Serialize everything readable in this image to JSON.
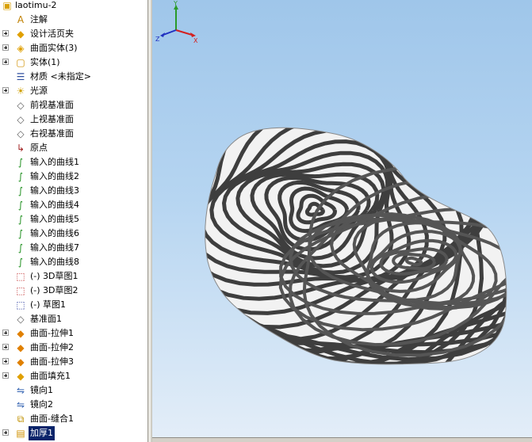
{
  "tree": {
    "root": {
      "label": "laotimu-2",
      "icon": "part-icon"
    },
    "items": [
      {
        "label": "注解",
        "icon": "annotation-icon",
        "expandable": false
      },
      {
        "label": "设计活页夹",
        "icon": "design-binder-icon",
        "expandable": true
      },
      {
        "label": "曲面实体(3)",
        "icon": "surface-bodies-icon",
        "expandable": true
      },
      {
        "label": "实体(1)",
        "icon": "solid-bodies-icon",
        "expandable": true
      },
      {
        "label": "材质 <未指定>",
        "icon": "material-icon",
        "expandable": false
      },
      {
        "label": "光源",
        "icon": "lights-icon",
        "expandable": true
      },
      {
        "label": "前视基准面",
        "icon": "plane-icon",
        "expandable": false
      },
      {
        "label": "上视基准面",
        "icon": "plane-icon",
        "expandable": false
      },
      {
        "label": "右视基准面",
        "icon": "plane-icon",
        "expandable": false
      },
      {
        "label": "原点",
        "icon": "origin-icon",
        "expandable": false
      },
      {
        "label": "输入的曲线1",
        "icon": "curve-icon",
        "expandable": false
      },
      {
        "label": "输入的曲线2",
        "icon": "curve-icon",
        "expandable": false
      },
      {
        "label": "输入的曲线3",
        "icon": "curve-icon",
        "expandable": false
      },
      {
        "label": "输入的曲线4",
        "icon": "curve-icon",
        "expandable": false
      },
      {
        "label": "输入的曲线5",
        "icon": "curve-icon",
        "expandable": false
      },
      {
        "label": "输入的曲线6",
        "icon": "curve-icon",
        "expandable": false
      },
      {
        "label": "输入的曲线7",
        "icon": "curve-icon",
        "expandable": false
      },
      {
        "label": "输入的曲线8",
        "icon": "curve-icon",
        "expandable": false
      },
      {
        "label": "(-) 3D草图1",
        "icon": "3d-sketch-icon",
        "expandable": false
      },
      {
        "label": "(-) 3D草图2",
        "icon": "3d-sketch-icon",
        "expandable": false
      },
      {
        "label": "(-) 草图1",
        "icon": "sketch-icon",
        "expandable": false
      },
      {
        "label": "基准面1",
        "icon": "plane-icon",
        "expandable": false
      },
      {
        "label": "曲面-拉伸1",
        "icon": "surface-extrude-icon",
        "expandable": true
      },
      {
        "label": "曲面-拉伸2",
        "icon": "surface-extrude-icon",
        "expandable": true
      },
      {
        "label": "曲面-拉伸3",
        "icon": "surface-extrude-icon",
        "expandable": true
      },
      {
        "label": "曲面填充1",
        "icon": "surface-fill-icon",
        "expandable": true
      },
      {
        "label": "镜向1",
        "icon": "mirror-icon",
        "expandable": false
      },
      {
        "label": "镜向2",
        "icon": "mirror-icon",
        "expandable": false
      },
      {
        "label": "曲面-缝合1",
        "icon": "knit-icon",
        "expandable": false
      },
      {
        "label": "加厚1",
        "icon": "thicken-icon",
        "expandable": true,
        "selected": true
      }
    ]
  },
  "triad": {
    "x": "X",
    "y": "Y",
    "z": "Z"
  },
  "colors": {
    "selection": "#0a246a",
    "viewport_top": "#9fc6ea",
    "viewport_bottom": "#e4eef8",
    "axis_x": "#d42020",
    "axis_y": "#2a9a2a",
    "axis_z": "#2030c0"
  }
}
